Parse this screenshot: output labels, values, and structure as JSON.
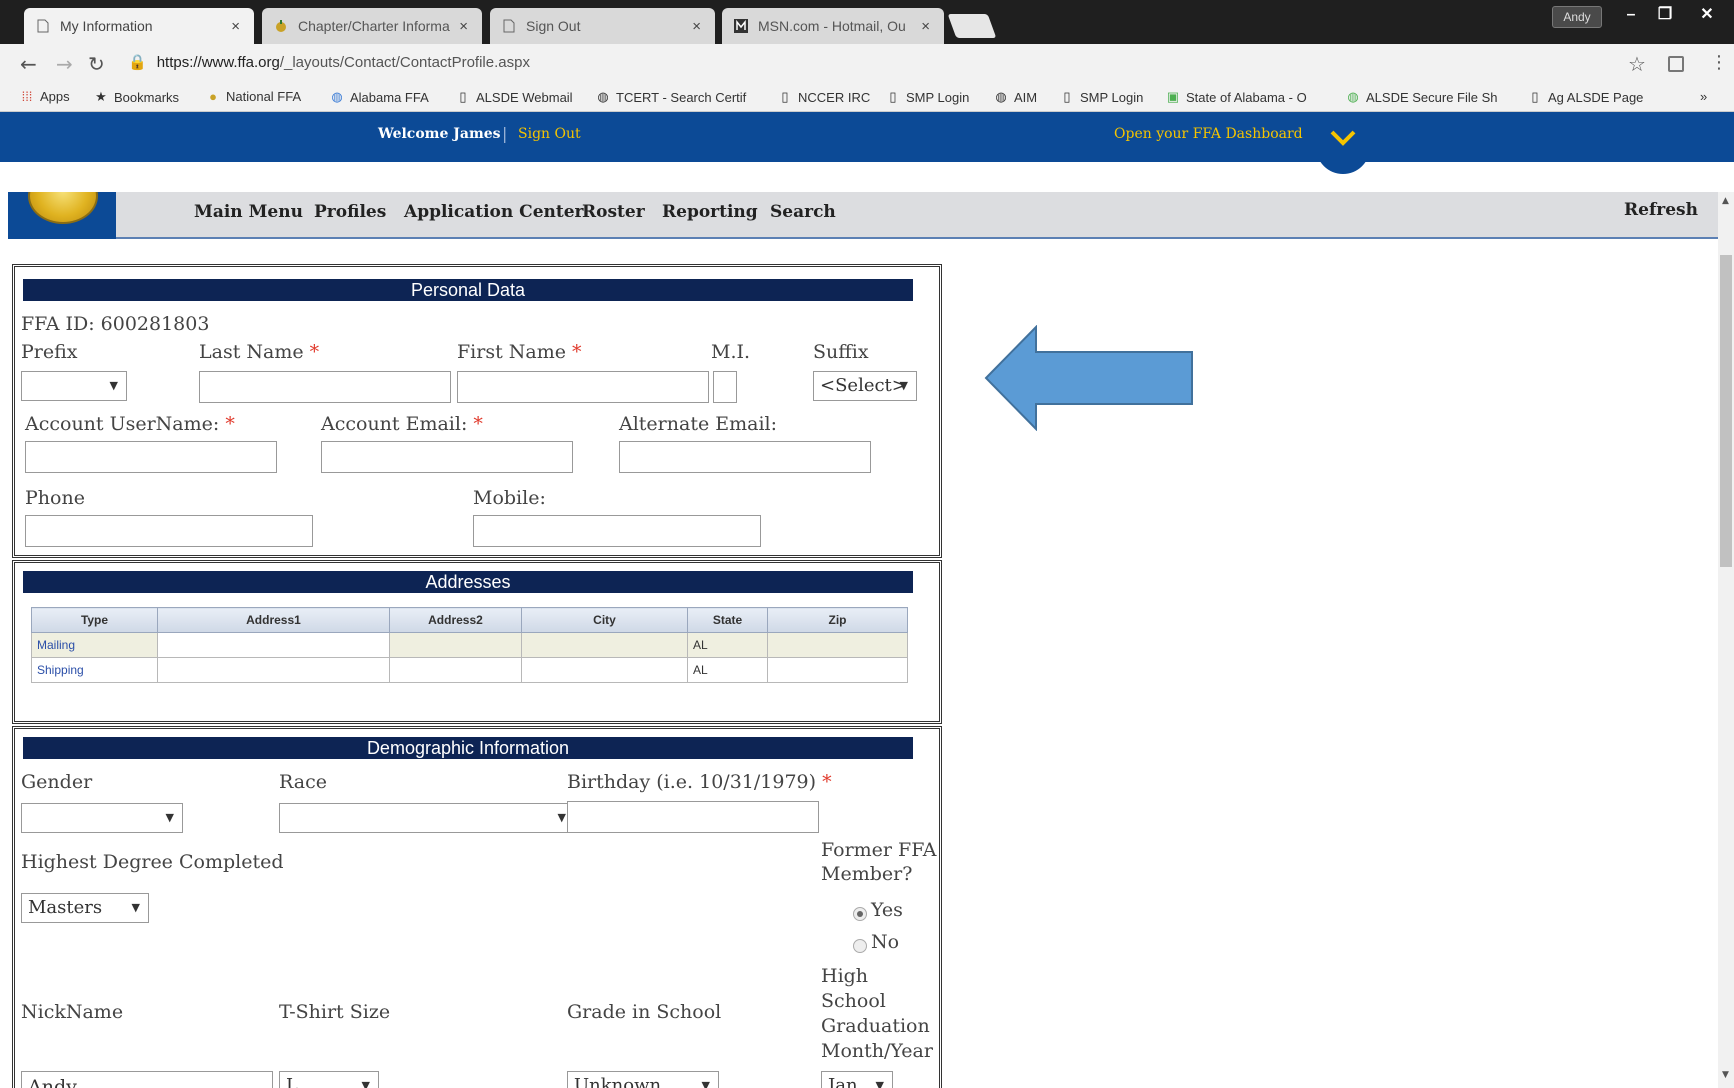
{
  "browser": {
    "tabs": [
      {
        "title": "My Information",
        "active": true
      },
      {
        "title": "Chapter/Charter Informa",
        "active": false
      },
      {
        "title": "Sign Out",
        "active": false
      },
      {
        "title": "MSN.com - Hotmail, Ou",
        "active": false
      }
    ],
    "user_button": "Andy",
    "url_host": "https://www.ffa.org",
    "url_path": "/_layouts/Contact/ContactProfile.aspx",
    "bookmarks": [
      {
        "label": "Apps",
        "icon": "apps-grid-icon"
      },
      {
        "label": "Bookmarks",
        "icon": "star-icon"
      },
      {
        "label": "National FFA",
        "icon": "ffa-logo-icon"
      },
      {
        "label": "Alabama FFA",
        "icon": "globe-icon"
      },
      {
        "label": "ALSDE Webmail",
        "icon": "page-icon"
      },
      {
        "label": "TCERT - Search Certif",
        "icon": "globe-icon"
      },
      {
        "label": "NCCER IRC",
        "icon": "page-icon"
      },
      {
        "label": "SMP Login",
        "icon": "page-icon"
      },
      {
        "label": "AIM",
        "icon": "globe-icon"
      },
      {
        "label": "SMP Login",
        "icon": "page-icon"
      },
      {
        "label": "State of Alabama - O",
        "icon": "state-icon"
      },
      {
        "label": "ALSDE Secure File Sh",
        "icon": "globe-icon"
      },
      {
        "label": "Ag ALSDE Page",
        "icon": "page-icon"
      }
    ]
  },
  "site_header": {
    "welcome": "Welcome James",
    "sign_out": "Sign Out",
    "dashboard": "Open your FFA Dashboard"
  },
  "nav": {
    "items": [
      "Main Menu",
      "Profiles",
      "Application Center",
      "Roster",
      "Reporting",
      "Search"
    ],
    "refresh": "Refresh"
  },
  "personal": {
    "title": "Personal Data",
    "ffa_id": "FFA ID: 600281803",
    "prefix": "Prefix",
    "last_name": "Last Name",
    "first_name": "First Name",
    "mi": "M.I.",
    "suffix": "Suffix",
    "suffix_value": "<Select>",
    "username": "Account UserName:",
    "email": "Account Email:",
    "alt_email": "Alternate Email:",
    "phone": "Phone",
    "mobile": "Mobile:",
    "required_mark": "*"
  },
  "addresses": {
    "title": "Addresses",
    "columns": [
      "Type",
      "Address1",
      "Address2",
      "City",
      "State",
      "Zip"
    ],
    "rows": [
      {
        "type": "Mailing",
        "state": "AL"
      },
      {
        "type": "Shipping",
        "state": "AL"
      }
    ]
  },
  "demographic": {
    "title": "Demographic Information",
    "gender": "Gender",
    "race": "Race",
    "birthday": "Birthday (i.e. 10/31/1979)",
    "highest_degree": "Highest Degree Completed",
    "highest_degree_value": "Masters",
    "former_member_1": "Former FFA",
    "former_member_2": "Member?",
    "yes": "Yes",
    "no": "No",
    "former_member_selected": "Yes",
    "nickname": "NickName",
    "nickname_value": "Andy",
    "tshirt": "T-Shirt Size",
    "tshirt_value": "L",
    "grade": "Grade in School",
    "grade_value": "Unknown",
    "hs_grad_1": "High",
    "hs_grad_2": "School",
    "hs_grad_3": "Graduation",
    "hs_grad_4": "Month/Year",
    "hs_grad_value": "Jan"
  },
  "colors": {
    "site_blue": "#0c4a96",
    "header_navy": "#0d2454",
    "accent_gold": "#f5c400",
    "required_red": "#e0392b",
    "annotation_arrow": "#5b9bd5"
  }
}
